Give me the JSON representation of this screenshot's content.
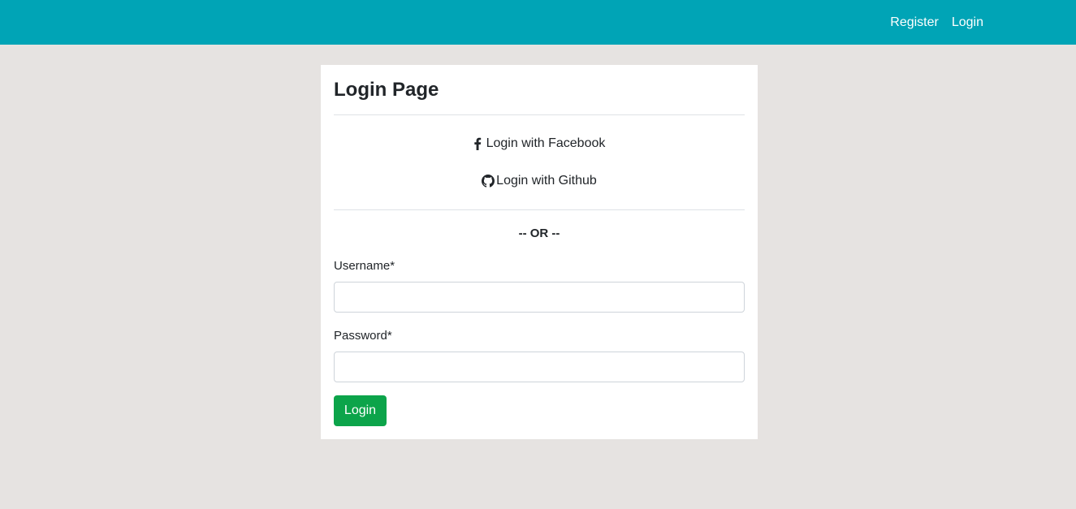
{
  "navbar": {
    "links": [
      "Register",
      "Login"
    ],
    "background": "#00a4b6"
  },
  "card": {
    "title": "Login Page",
    "social": {
      "facebook_label": "Login with Facebook",
      "facebook_icon": "facebook-icon",
      "github_label": "Login with Github",
      "github_icon": "github-icon"
    },
    "or_text": "-- OR --",
    "form": {
      "username_label": "Username*",
      "username_value": "",
      "password_label": "Password*",
      "password_value": "",
      "submit_label": "Login",
      "submit_color": "#0ca44a"
    }
  }
}
